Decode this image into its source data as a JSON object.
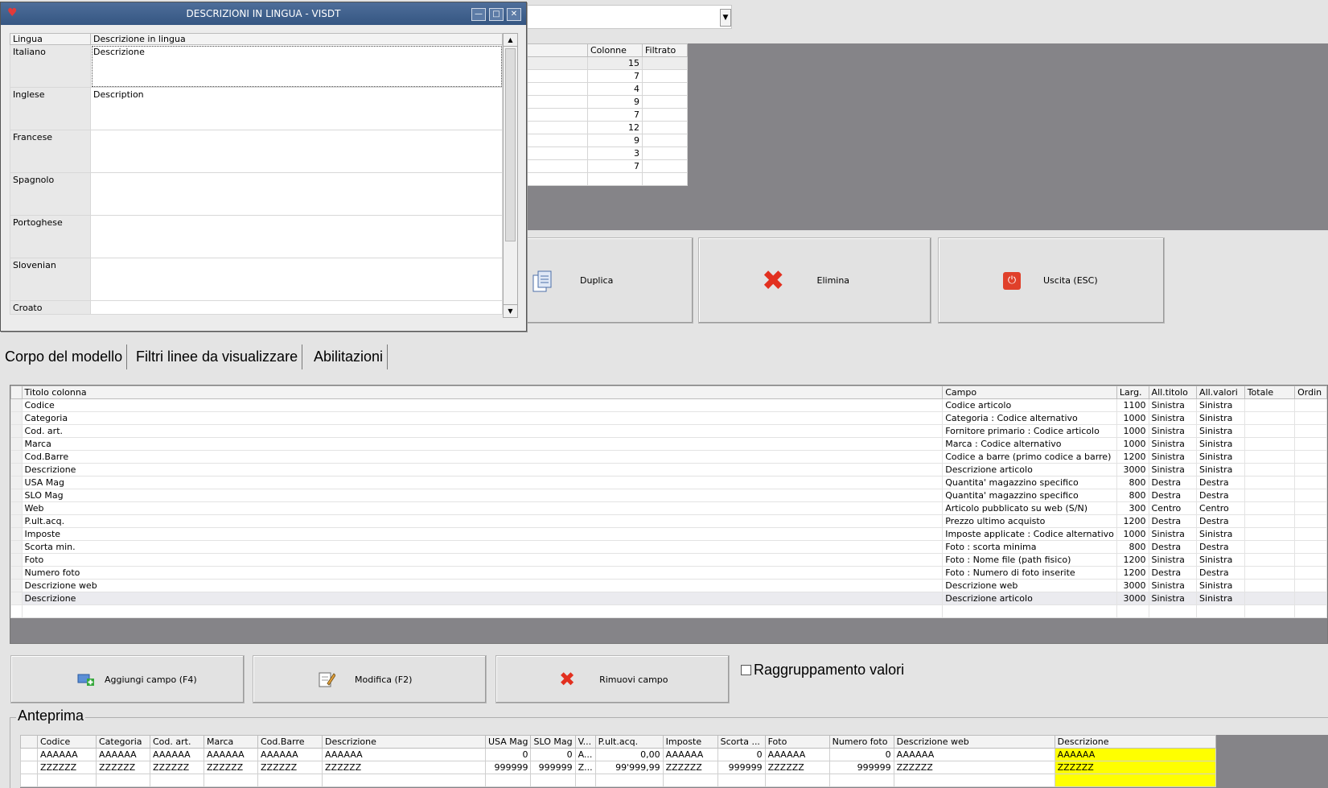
{
  "dialog": {
    "title": "DESCRIZIONI IN LINGUA - VISDT",
    "col_lang": "Lingua",
    "col_desc": "Descrizione in lingua",
    "rows": [
      {
        "lang": "Italiano",
        "desc": "Descrizione"
      },
      {
        "lang": "Inglese",
        "desc": "Description"
      },
      {
        "lang": "Francese",
        "desc": ""
      },
      {
        "lang": "Spagnolo",
        "desc": ""
      },
      {
        "lang": "Portoghese",
        "desc": ""
      },
      {
        "lang": "Slovenian",
        "desc": ""
      },
      {
        "lang": "Croato",
        "desc": ""
      }
    ]
  },
  "top_grid": {
    "col_colonne": "Colonne",
    "col_filtrato": "Filtrato",
    "rows": [
      "15",
      "7",
      "4",
      "9",
      "7",
      "12",
      "9",
      "3",
      "7",
      ""
    ]
  },
  "buttons": {
    "duplica": "Duplica",
    "elimina": "Elimina",
    "uscita": "Uscita (ESC)",
    "aggiungi": "Aggiungi campo (F4)",
    "modifica": "Modifica (F2)",
    "rimuovi": "Rimuovi campo"
  },
  "tabs": [
    "Corpo del modello",
    "Filtri linee da visualizzare",
    "Abilitazioni"
  ],
  "main_grid": {
    "headers": [
      "Titolo colonna",
      "Campo",
      "Larg.",
      "All.titolo",
      "All.valori",
      "Totale",
      "Ordin"
    ],
    "rows": [
      [
        "Codice",
        "Codice articolo",
        "1100",
        "Sinistra",
        "Sinistra"
      ],
      [
        "Categoria",
        "Categoria : Codice alternativo",
        "1000",
        "Sinistra",
        "Sinistra"
      ],
      [
        "Cod. art.",
        "Fornitore primario : Codice articolo",
        "1000",
        "Sinistra",
        "Sinistra"
      ],
      [
        "Marca",
        "Marca : Codice alternativo",
        "1000",
        "Sinistra",
        "Sinistra"
      ],
      [
        "Cod.Barre",
        "Codice a barre (primo codice a barre)",
        "1200",
        "Sinistra",
        "Sinistra"
      ],
      [
        "Descrizione",
        "Descrizione articolo",
        "3000",
        "Sinistra",
        "Sinistra"
      ],
      [
        "USA Mag",
        "Quantita' magazzino specifico",
        "800",
        "Destra",
        "Destra"
      ],
      [
        "SLO Mag",
        "Quantita' magazzino specifico",
        "800",
        "Destra",
        "Destra"
      ],
      [
        "Web",
        "Articolo pubblicato su web (S/N)",
        "300",
        "Centro",
        "Centro"
      ],
      [
        "P.ult.acq.",
        "Prezzo ultimo acquisto",
        "1200",
        "Destra",
        "Destra"
      ],
      [
        "Imposte",
        "Imposte applicate : Codice alternativo",
        "1000",
        "Sinistra",
        "Sinistra"
      ],
      [
        "Scorta min.",
        "Foto : scorta minima",
        "800",
        "Destra",
        "Destra"
      ],
      [
        "Foto",
        "Foto : Nome file (path fisico)",
        "1200",
        "Sinistra",
        "Sinistra"
      ],
      [
        "Numero foto",
        "Foto : Numero di foto inserite",
        "1200",
        "Destra",
        "Destra"
      ],
      [
        "Descrizione web",
        "Descrizione web",
        "3000",
        "Sinistra",
        "Sinistra"
      ],
      [
        "Descrizione",
        "Descrizione articolo",
        "3000",
        "Sinistra",
        "Sinistra"
      ]
    ]
  },
  "checkbox_label": "Raggruppamento valori",
  "preview": {
    "title": "Anteprima",
    "headers": [
      "Codice",
      "Categoria",
      "Cod. art.",
      "Marca",
      "Cod.Barre",
      "Descrizione",
      "USA Mag",
      "SLO Mag",
      "V...",
      "P.ult.acq.",
      "Imposte",
      "Scorta ...",
      "Foto",
      "Numero foto",
      "Descrizione web",
      "Descrizione"
    ],
    "rows": [
      [
        "AAAAAA",
        "AAAAAA",
        "AAAAAA",
        "AAAAAA",
        "AAAAAA",
        "AAAAAA",
        "0",
        "0",
        "A...",
        "0,00",
        "AAAAAA",
        "0",
        "AAAAAA",
        "0",
        "AAAAAA",
        "AAAAAA"
      ],
      [
        "ZZZZZZ",
        "ZZZZZZ",
        "ZZZZZZ",
        "ZZZZZZ",
        "ZZZZZZ",
        "ZZZZZZ",
        "999999",
        "999999",
        "Z...",
        "99'999,99",
        "ZZZZZZ",
        "999999",
        "ZZZZZZ",
        "999999",
        "ZZZZZZ",
        "ZZZZZZ"
      ]
    ]
  },
  "colors": {
    "highlight": "#ffff00",
    "title_bar": "#4e6e9a",
    "grid_bg": "#858488"
  }
}
